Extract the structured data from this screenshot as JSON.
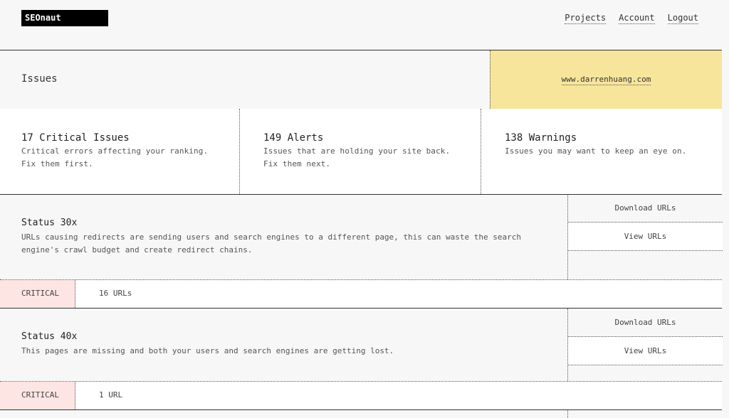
{
  "header": {
    "logo": "SEOnaut",
    "nav": [
      "Projects",
      "Account",
      "Logout"
    ]
  },
  "page": {
    "title": "Issues",
    "site": "www.darrenhuang.com"
  },
  "stats": [
    {
      "title": "17 Critical Issues",
      "line1": "Critical errors affecting your ranking.",
      "line2": "Fix them first."
    },
    {
      "title": "149 Alerts",
      "line1": "Issues that are holding your site back.",
      "line2": "Fix them next."
    },
    {
      "title": "138 Warnings",
      "line1": "Issues you may want to keep an eye on.",
      "line2": ""
    }
  ],
  "issues": [
    {
      "title": "Status 30x",
      "description": "URLs causing redirects are sending users and search engines to a different page, this can waste the search engine's crawl budget and create redirect chains.",
      "download_label": "Download URLs",
      "view_label": "View URLs",
      "severity": "CRITICAL",
      "count": "16 URLs"
    },
    {
      "title": "Status 40x",
      "description": "This pages are missing and both your users and search engines are getting lost.",
      "download_label": "Download URLs",
      "view_label": "View URLs",
      "severity": "CRITICAL",
      "count": "1 URL"
    }
  ],
  "colors": {
    "site_highlight": "#f6e59a",
    "critical_badge": "#fde5e3",
    "background": "#f7f7f7"
  }
}
